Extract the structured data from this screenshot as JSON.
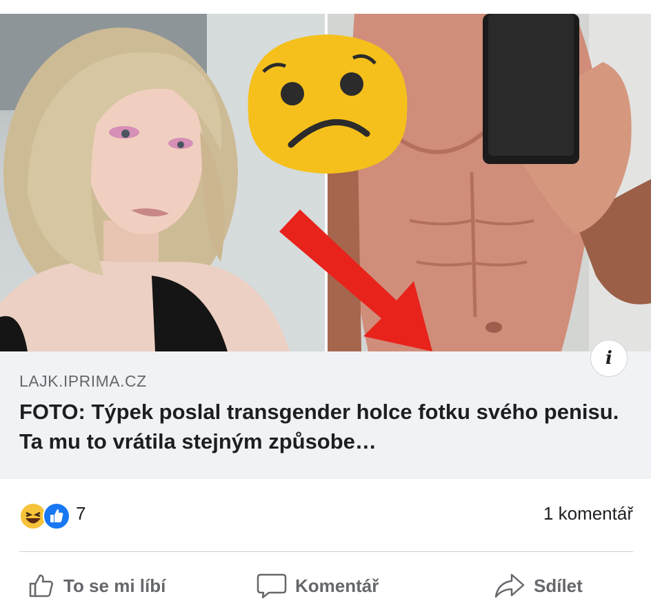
{
  "post": {
    "link_card": {
      "domain": "LAJK.IPRIMA.CZ",
      "headline": "FOTO: Týpek poslal transgender holce fotku svého penisu. Ta mu to vrátila stejným způsobe…",
      "info_badge": "i"
    },
    "reactions": {
      "icons": [
        "haha-reaction-icon",
        "like-reaction-icon"
      ],
      "count": "7",
      "comments": "1 komentář"
    },
    "actions": [
      {
        "label": "To se mi líbí",
        "icon": "thumbs-up-icon"
      },
      {
        "label": "Komentář",
        "icon": "comment-bubble-icon"
      },
      {
        "label": "Sdílet",
        "icon": "share-arrow-icon"
      }
    ]
  },
  "colors": {
    "card_background": "#f0f2f5",
    "secondary_text": "#65676b",
    "primary_text": "#1c1e21",
    "like_blue": "#1877f2",
    "haha_yellow": "#f7c33a",
    "arrow_red": "#e8231c",
    "emoji_yellow": "#f5c01b"
  }
}
